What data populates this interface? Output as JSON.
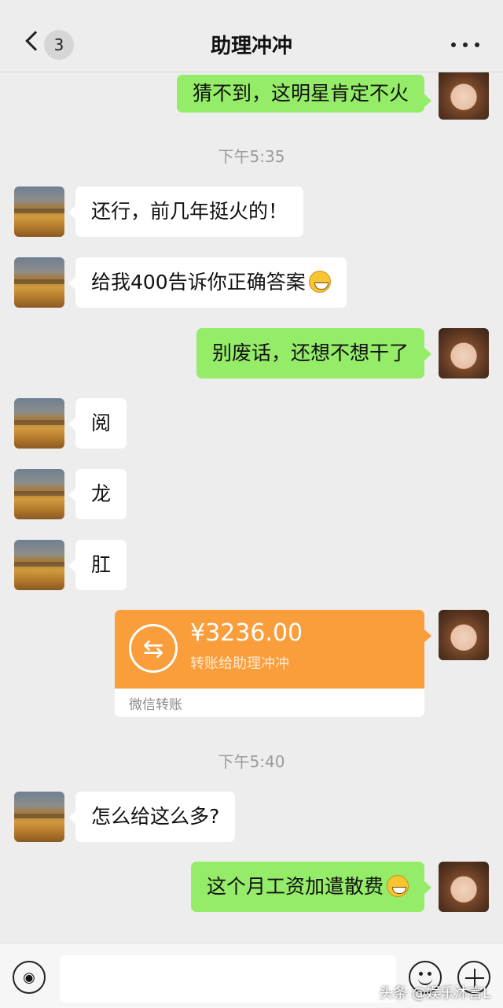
{
  "header": {
    "unread_count": "3",
    "title": "助理冲冲"
  },
  "messages": [
    {
      "side": "right",
      "text": "猜不到，这明星肯定不火"
    },
    {
      "side": "left",
      "text": "还行，前几年挺火的！"
    },
    {
      "side": "left",
      "text": "给我400告诉你正确答案",
      "emoji": "grin-emoji"
    },
    {
      "side": "right",
      "text": "别废话，还想不想干了"
    },
    {
      "side": "left",
      "text": "阅"
    },
    {
      "side": "left",
      "text": "龙"
    },
    {
      "side": "left",
      "text": "肛"
    },
    {
      "side": "left",
      "text": "怎么给这么多?"
    },
    {
      "side": "right",
      "text": "这个月工资加遣散费",
      "emoji": "thinking-emoji"
    }
  ],
  "timestamps": [
    "下午5:35",
    "下午5:40"
  ],
  "transfer": {
    "amount": "¥3236.00",
    "description": "转账给助理冲冲",
    "footer": "微信转账",
    "color": "#fa9d3b"
  },
  "input_bar": {
    "placeholder": ""
  },
  "watermark": "头条 @娱乐沐言L",
  "colors": {
    "background": "#ededed",
    "green_bubble": "#95ec69",
    "white_bubble": "#ffffff"
  }
}
